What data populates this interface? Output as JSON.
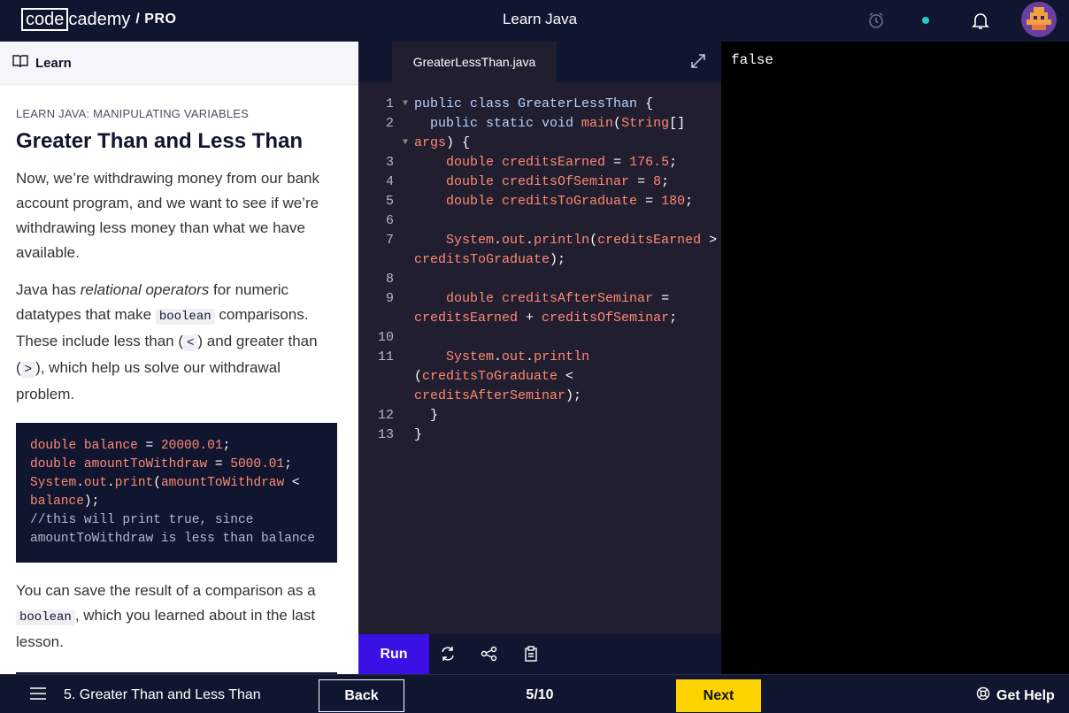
{
  "header": {
    "logo_box": "code",
    "logo_rest": "cademy",
    "logo_pro": "/ PRO",
    "title": "Learn Java"
  },
  "learn_panel": {
    "header_label": "Learn",
    "eyebrow": "LEARN JAVA: MANIPULATING VARIABLES",
    "heading": "Greater Than and Less Than",
    "para1": "Now, we’re withdrawing money from our bank account program, and we want to see if we’re withdrawing less money than what we have available.",
    "para2_a": "Java has ",
    "para2_em": "relational operators",
    "para2_b": " for numeric datatypes that make ",
    "para2_code1": "boolean",
    "para2_c": " comparisons. These include less than (",
    "para2_code2": "<",
    "para2_d": ") and greater than (",
    "para2_code3": ">",
    "para2_e": "), which help us solve our withdrawal problem.",
    "para3_a": "You can save the result of a comparison as a ",
    "para3_code": "boolean",
    "para3_b": ", which you learned about in the last lesson.",
    "snippet": {
      "l1_type": "double",
      "l1_name": "balance",
      "l1_eq": " = ",
      "l1_val": "20000.01",
      "l1_end": ";",
      "l2_type": "double",
      "l2_name": "amountToWithdraw",
      "l2_eq": " = ",
      "l2_val": "5000.01",
      "l2_end": ";",
      "l3_sys": "System",
      "l3_dot1": ".",
      "l3_out": "out",
      "l3_dot2": ".",
      "l3_print": "print",
      "l3_paren": "(",
      "l3_arg": "amountToWithdraw",
      "l3_op": " <",
      "l4_arg": "balance",
      "l4_end": ");",
      "comment": "//this will print true, since amountToWithdraw is less than balance"
    }
  },
  "editor": {
    "tab": "GreaterLessThan.java",
    "lines": [
      {
        "n": "1"
      },
      {
        "n": "2"
      },
      {
        "n": ""
      },
      {
        "n": "3"
      },
      {
        "n": "4"
      },
      {
        "n": "5"
      },
      {
        "n": "6"
      },
      {
        "n": "7"
      },
      {
        "n": ""
      },
      {
        "n": "8"
      },
      {
        "n": "9"
      },
      {
        "n": ""
      },
      {
        "n": "10"
      },
      {
        "n": "11"
      },
      {
        "n": ""
      },
      {
        "n": ""
      },
      {
        "n": "12"
      },
      {
        "n": "13"
      }
    ],
    "code": {
      "c1_kw": "public class ",
      "c1_name": "GreaterLessThan",
      "c1_end": " {",
      "c2_kw": "  public static void ",
      "c2_fn": "main",
      "c2_p": "(",
      "c2_ty": "String",
      "c2_end": "[]",
      "c3_arg": "args",
      "c3_end": ") {",
      "c4_ty": "    double ",
      "c4_id": "creditsEarned",
      "c4_eq": " = ",
      "c4_n": "176.5",
      "c4_e": ";",
      "c5_ty": "    double ",
      "c5_id": "creditsOfSeminar",
      "c5_eq": " = ",
      "c5_n": "8",
      "c5_e": ";",
      "c6_ty": "    double ",
      "c6_id": "creditsToGraduate",
      "c6_eq": " = ",
      "c6_n": "180",
      "c6_e": ";",
      "c7_sys": "    System",
      "c7_d1": ".",
      "c7_out": "out",
      "c7_d2": ".",
      "c7_fn": "println",
      "c7_p": "(",
      "c7_id": "creditsEarned",
      "c7_op": " >",
      "c8_id": "creditsToGraduate",
      "c8_e": ");",
      "c9_ty": "    double ",
      "c9_id": "creditsAfterSeminar",
      "c9_eq": " =",
      "c10_id1": "creditsEarned",
      "c10_op": " + ",
      "c10_id2": "creditsOfSeminar",
      "c10_e": ";",
      "c11_sys": "    System",
      "c11_d1": ".",
      "c11_out": "out",
      "c11_d2": ".",
      "c11_fn": "println",
      "c12_p": "(",
      "c12_id": "creditsToGraduate",
      "c12_op": " <",
      "c13_id": "creditsAfterSeminar",
      "c13_e": ");",
      "c14": "  }",
      "c15": "}"
    },
    "run_label": "Run"
  },
  "output": {
    "text": "false"
  },
  "footer": {
    "lesson": "5. Greater Than and Less Than",
    "back": "Back",
    "progress": "5/10",
    "next": "Next",
    "help": "Get Help"
  },
  "colors": {
    "navy": "#10162f",
    "editor_bg": "#211e2f",
    "run": "#3a10e5",
    "next": "#ffd300",
    "status_dot": "#25c9c9"
  }
}
